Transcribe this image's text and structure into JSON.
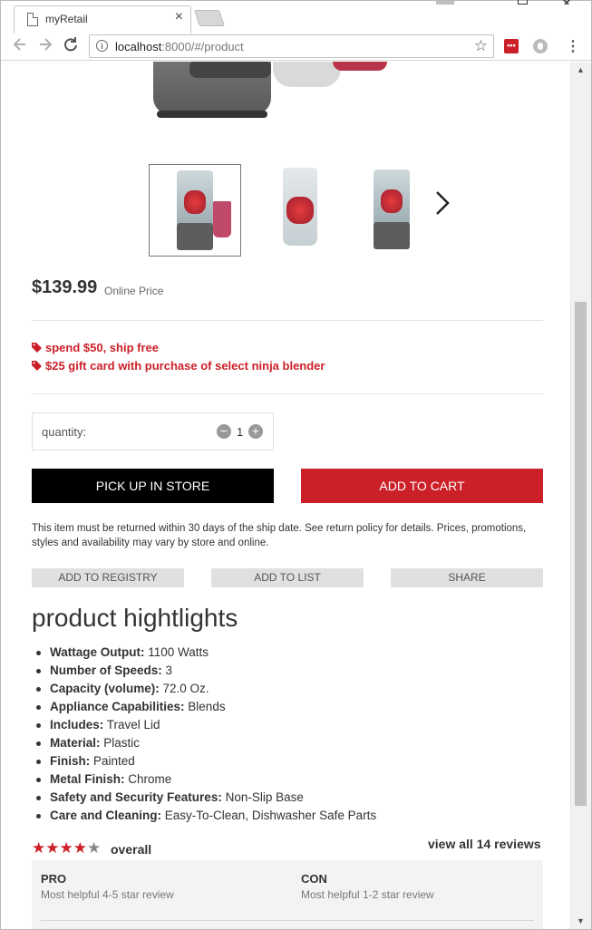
{
  "browser": {
    "tab_title": "myRetail",
    "tab_close": "×",
    "url_host": "localhost",
    "url_path": ":8000/#/product",
    "ext_lastpass": "•••",
    "menu": "⋮"
  },
  "product": {
    "price": "$139.99",
    "price_label": "Online Price",
    "promotions": [
      "spend $50, ship free",
      "$25 gift card with purchase of select ninja blender"
    ],
    "quantity_label": "quantity:",
    "quantity_value": "1",
    "pickup_label": "PICK UP IN STORE",
    "cart_label": "ADD TO CART",
    "return_note": "This item must be returned within 30 days of the ship date. See return policy for details. Prices, promotions, styles and availability may vary by store and online.",
    "registry_label": "ADD TO REGISTRY",
    "list_label": "ADD TO LIST",
    "share_label": "SHARE"
  },
  "highlights": {
    "title": "product hightlights",
    "items": [
      {
        "key": "Wattage Output:",
        "value": " 1100 Watts"
      },
      {
        "key": "Number of Speeds:",
        "value": " 3"
      },
      {
        "key": "Capacity (volume):",
        "value": " 72.0 Oz."
      },
      {
        "key": "Appliance Capabilities:",
        "value": " Blends"
      },
      {
        "key": "Includes:",
        "value": " Travel Lid"
      },
      {
        "key": "Material:",
        "value": " Plastic"
      },
      {
        "key": "Finish:",
        "value": " Painted"
      },
      {
        "key": "Metal Finish:",
        "value": " Chrome"
      },
      {
        "key": "Safety and Security Features:",
        "value": " Non-Slip Base"
      },
      {
        "key": "Care and Cleaning:",
        "value": " Easy-To-Clean, Dishwasher Safe Parts"
      }
    ]
  },
  "reviews": {
    "rating": 4,
    "max_rating": 5,
    "overall_label": "overall",
    "view_all_label": "view all 14 reviews",
    "pro_title": "PRO",
    "pro_sub": "Most helpful 4-5 star review",
    "con_title": "CON",
    "con_sub": "Most helpful 1-2 star review"
  },
  "colors": {
    "accent": "#cc2029",
    "button_dark": "#000000",
    "secondary_button": "#e0e0e0"
  }
}
